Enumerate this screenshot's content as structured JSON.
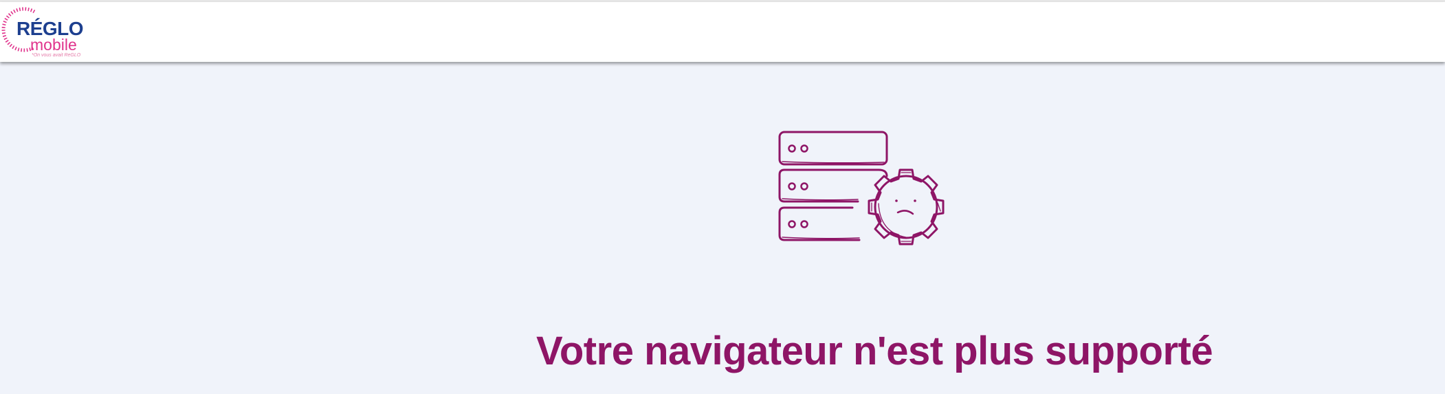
{
  "header": {
    "logo": {
      "brand": "RÉGLO",
      "sub": "mobile",
      "tagline": "*On vous avait ReGLO",
      "colors": {
        "primary": "#1d3f8f",
        "accent": "#e0338c"
      }
    }
  },
  "main": {
    "illustration": {
      "icon": "server-gear-sad-face-icon",
      "color": "#8e1566"
    },
    "headline": "Votre navigateur n'est plus supporté"
  },
  "theme": {
    "background": "#f0f3fa",
    "header_background": "#ffffff",
    "headline_color": "#8e1566"
  }
}
